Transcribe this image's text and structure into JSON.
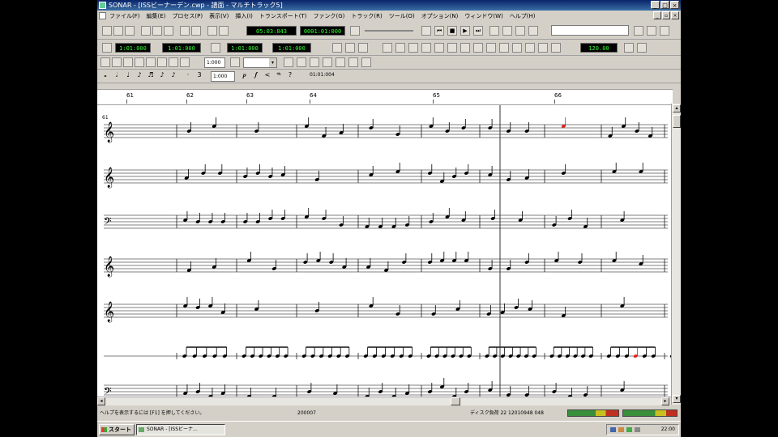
{
  "window": {
    "title": "SONAR - [ISSビーナーデン.cwp - 譜面 - マルチトラック5]",
    "controls": [
      "_",
      "□",
      "×"
    ]
  },
  "menubar": {
    "items": [
      "ファイル(F)",
      "編集(E)",
      "プロセス(P)",
      "表示(V)",
      "挿入(I)",
      "トランスポート(T)",
      "ファンク(G)",
      "トラック(R)",
      "ツール(O)",
      "オプション(N)",
      "ウィンドウ(W)",
      "ヘルプ(H)"
    ]
  },
  "toolbar": {
    "now_time": "05:03:843",
    "now_time2": "0001:01:000",
    "loop_start": "1:01:000",
    "loop_end": "1:01:000",
    "punch_start": "1:01:000",
    "punch_end": "1:01:000",
    "tempo": "120.00",
    "snap_value": "1:000",
    "duration_value": "1:000",
    "position_readout": "01:01:004",
    "pattern_combo": ""
  },
  "ruler": {
    "measures": [
      "61",
      "62",
      "63",
      "64",
      "65",
      "66"
    ]
  },
  "staff": {
    "measure_number": "61",
    "playhead_color": "#303030",
    "highlight_note_color": "#e02020",
    "clefs": [
      "treble",
      "treble",
      "bass",
      "treble",
      "treble",
      "percussion",
      "bass"
    ]
  },
  "statusbar": {
    "hint": "ヘルプを表示するには [F1] を押してください。",
    "position": "200007",
    "disk_load": "ディスク負荷 22 12010948 048",
    "meter_colors": [
      "#3a8f3a",
      "#c8c020",
      "#c03020"
    ]
  },
  "taskbar": {
    "start_label": "スタート",
    "task_label": "SONAR - [ISSビーナ...",
    "clock": "22:00"
  }
}
